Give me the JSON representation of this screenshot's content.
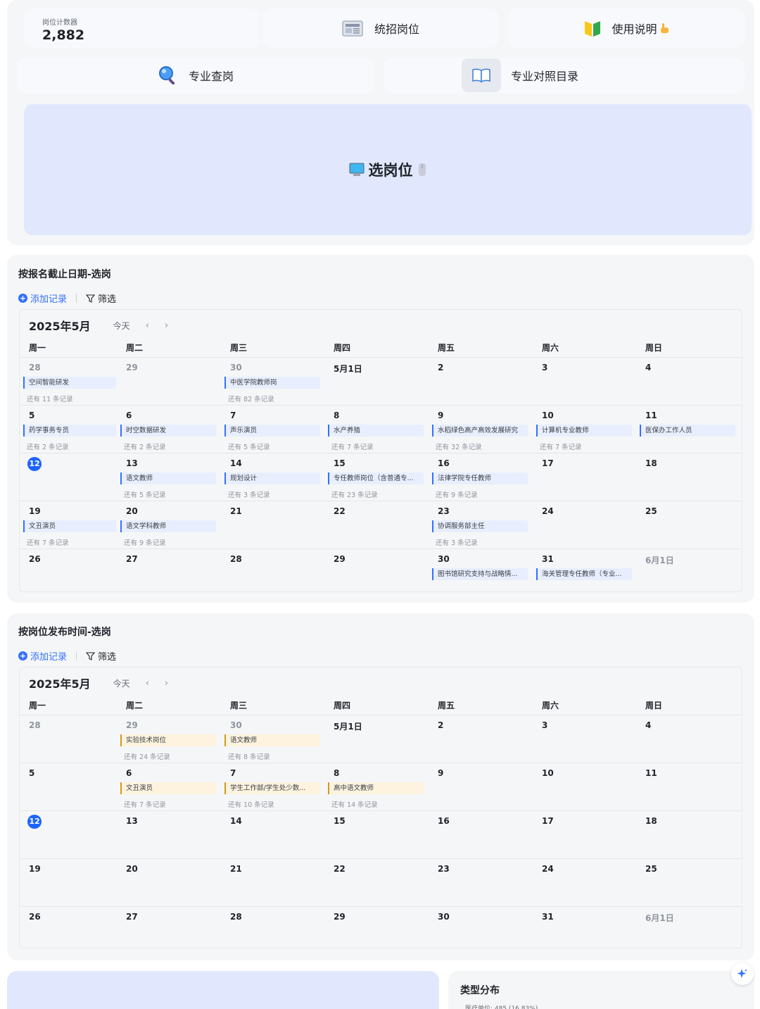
{
  "top": {
    "counter_label": "岗位计数器",
    "counter_value": "2,882",
    "card_recruit": "统招岗位",
    "card_guide": "使用说明",
    "card_search": "专业查岗",
    "card_catalog": "专业对照目录",
    "big_button": "选岗位"
  },
  "cal1": {
    "title": "按报名截止日期-选岗",
    "add": "添加记录",
    "filter": "筛选",
    "month": "2025年5月",
    "today": "今天",
    "prev": "‹",
    "next": "›",
    "weekdays": [
      "周一",
      "周二",
      "周三",
      "周四",
      "周五",
      "周六",
      "周日"
    ],
    "weeks": [
      [
        "28",
        "29",
        "30",
        "5月1日",
        "2",
        "3",
        "4"
      ],
      [
        "5",
        "6",
        "7",
        "8",
        "9",
        "10",
        "11"
      ],
      [
        "12",
        "13",
        "14",
        "15",
        "16",
        "17",
        "18"
      ],
      [
        "19",
        "20",
        "21",
        "22",
        "23",
        "24",
        "25"
      ],
      [
        "26",
        "27",
        "28",
        "29",
        "30",
        "31",
        "6月1日"
      ]
    ],
    "events": {
      "w0d0": "空间智能研发",
      "w0d0m": "还有 11 条记录",
      "w0d2": "中医学院教师岗",
      "w0d2m": "还有 82 条记录",
      "w1d0": "药学事务专员",
      "w1d0m": "还有 2 条记录",
      "w1d1": "时空数据研发",
      "w1d1m": "还有 2 条记录",
      "w1d2": "声乐演员",
      "w1d2m": "还有 5 条记录",
      "w1d3": "水产养殖",
      "w1d3m": "还有 7 条记录",
      "w1d4": "水稻绿色高产高效发展研究",
      "w1d4m": "还有 32 条记录",
      "w1d5": "计算机专业教师",
      "w1d5m": "还有 7 条记录",
      "w1d6": "医保办工作人员",
      "w2d1": "语文教师",
      "w2d1m": "还有 5 条记录",
      "w2d2": "规划设计",
      "w2d2m": "还有 3 条记录",
      "w2d3": "专任教师岗位（含普通专...",
      "w2d3m": "还有 23 条记录",
      "w2d4": "法律学院专任教师",
      "w2d4m": "还有 9 条记录",
      "w3d0": "文丑演员",
      "w3d0m": "还有 7 条记录",
      "w3d1": "语文学科教师",
      "w3d1m": "还有 9 条记录",
      "w3d4": "协调服务部主任",
      "w3d4m": "还有 3 条记录",
      "w4d4": "图书馆研究支持与战略情...",
      "w4d5": "海关管理专任教师（专业..."
    }
  },
  "cal2": {
    "title": "按岗位发布时间-选岗",
    "add": "添加记录",
    "filter": "筛选",
    "month": "2025年5月",
    "today": "今天",
    "prev": "‹",
    "next": "›",
    "weekdays": [
      "周一",
      "周二",
      "周三",
      "周四",
      "周五",
      "周六",
      "周日"
    ],
    "weeks": [
      [
        "28",
        "29",
        "30",
        "5月1日",
        "2",
        "3",
        "4"
      ],
      [
        "5",
        "6",
        "7",
        "8",
        "9",
        "10",
        "11"
      ],
      [
        "12",
        "13",
        "14",
        "15",
        "16",
        "17",
        "18"
      ],
      [
        "19",
        "20",
        "21",
        "22",
        "23",
        "24",
        "25"
      ],
      [
        "26",
        "27",
        "28",
        "29",
        "30",
        "31",
        "6月1日"
      ]
    ],
    "events": {
      "w0d1": "实验技术岗位",
      "w0d1m": "还有 24 条记录",
      "w0d2": "语文教师",
      "w0d2m": "还有 8 条记录",
      "w1d1": "文丑演员",
      "w1d1m": "还有 7 条记录",
      "w1d2": "学生工作部/学生处少数...",
      "w1d2m": "还有 10 条记录",
      "w1d3": "高中语文教师",
      "w1d3m": "还有 14 条记录"
    }
  },
  "bottom": {
    "type_title": "类型分布",
    "type_sub": "医疗单位: 485 (16.83%)"
  },
  "colors": {
    "accent": "#3370ff",
    "today": "#1d63ff",
    "gold": "#d49a1a",
    "card_bg": "#e1e8fd"
  }
}
